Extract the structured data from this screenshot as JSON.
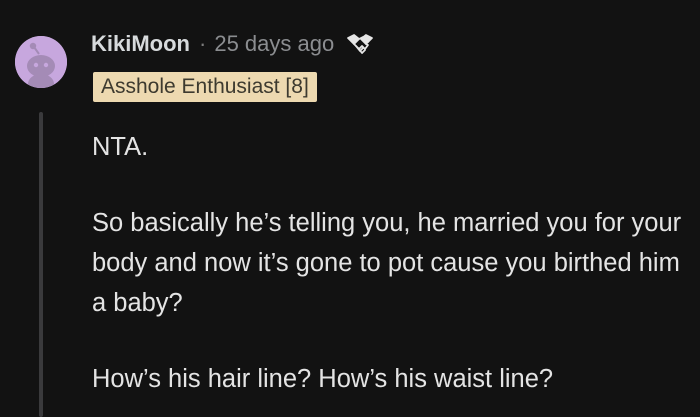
{
  "comment": {
    "author": "KikiMoon",
    "separator": "·",
    "timestamp": "25 days ago",
    "award_icon": "handshake-award-icon",
    "flair": "Asshole Enthusiast [8]",
    "paragraphs": [
      "NTA.",
      "So basically he’s telling you, he married you for your body and now it’s gone to pot cause you birthed him a baby?",
      "How’s his hair line? How’s his waist line?"
    ]
  },
  "colors": {
    "background": "#121212",
    "avatar_background": "#c7a7de",
    "flair_background": "#edd9b0",
    "flair_text": "#3d3a2f",
    "thread_line": "#3a3a3c"
  }
}
